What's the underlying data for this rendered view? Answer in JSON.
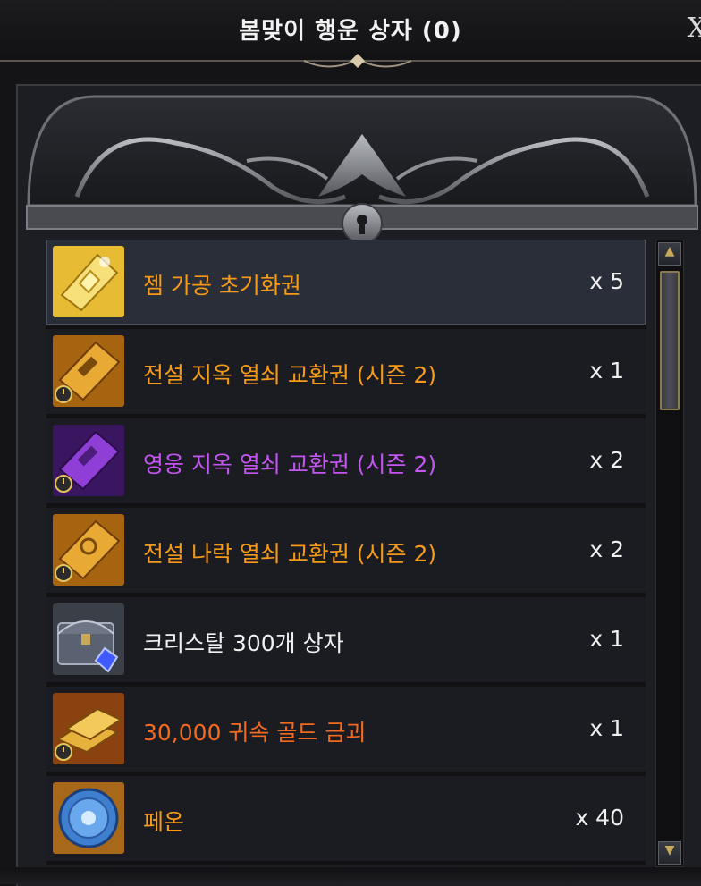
{
  "window": {
    "title": "봄맞이 행운 상자 (0)",
    "close_label": "X"
  },
  "items": [
    {
      "name": "젬 가공 초기화권",
      "qty": "x 5",
      "color": "#f79a18",
      "icon": "gem-reset-ticket-icon",
      "selected": true
    },
    {
      "name": "전설 지옥 열쇠 교환권 (시즌 2)",
      "qty": "x 1",
      "color": "#f79a18",
      "icon": "legendary-hell-key-ticket-icon"
    },
    {
      "name": "영웅 지옥 열쇠 교환권 (시즌 2)",
      "qty": "x 2",
      "color": "#c555f2",
      "icon": "epic-hell-key-ticket-icon"
    },
    {
      "name": "전설 나락 열쇠 교환권 (시즌 2)",
      "qty": "x 2",
      "color": "#f79a18",
      "icon": "legendary-abyss-key-ticket-icon"
    },
    {
      "name": "크리스탈 300개 상자",
      "qty": "x 1",
      "color": "#f0f0f0",
      "icon": "crystal-chest-icon"
    },
    {
      "name": "30,000 귀속 골드 금괴",
      "qty": "x 1",
      "color": "#f36a1f",
      "icon": "gold-bar-icon"
    },
    {
      "name": "페온",
      "qty": "x 40",
      "color": "#f79a18",
      "icon": "pheon-coin-icon"
    }
  ]
}
